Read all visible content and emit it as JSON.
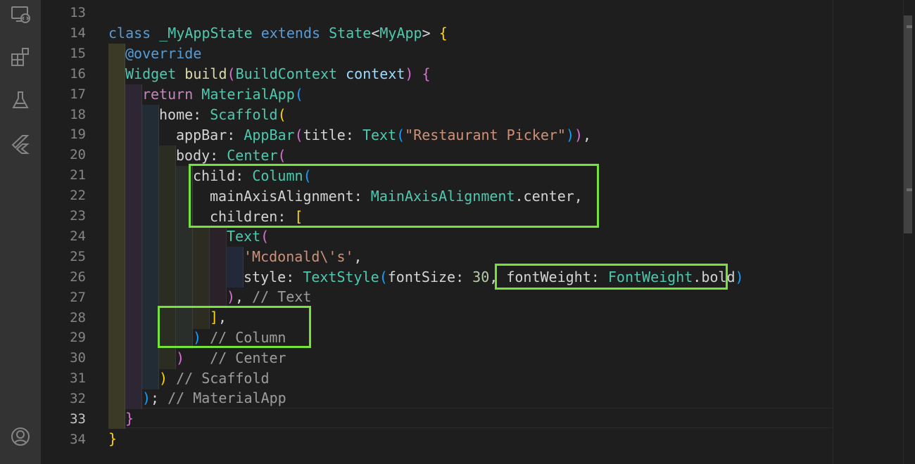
{
  "activity_bar": {
    "items": [
      {
        "name": "remote-explorer-icon"
      },
      {
        "name": "extensions-icon"
      },
      {
        "name": "testing-icon"
      },
      {
        "name": "flutter-icon"
      }
    ],
    "bottom": [
      {
        "name": "account-icon"
      }
    ]
  },
  "editor": {
    "active_line": 33,
    "lines": [
      {
        "n": 13,
        "text": ""
      },
      {
        "n": 14,
        "text": "class _MyAppState extends State<MyApp> {"
      },
      {
        "n": 15,
        "text": "@override"
      },
      {
        "n": 16,
        "text": "Widget build(BuildContext context) {"
      },
      {
        "n": 17,
        "text": "return MaterialApp("
      },
      {
        "n": 18,
        "text": "home: Scaffold("
      },
      {
        "n": 19,
        "text": "appBar: AppBar(title: Text(\"Restaurant Picker\")),"
      },
      {
        "n": 20,
        "text": "body: Center("
      },
      {
        "n": 21,
        "text": "child: Column("
      },
      {
        "n": 22,
        "text": "mainAxisAlignment: MainAxisAlignment.center,"
      },
      {
        "n": 23,
        "text": "children: ["
      },
      {
        "n": 24,
        "text": "Text("
      },
      {
        "n": 25,
        "text": "'Mcdonald\\'s',"
      },
      {
        "n": 26,
        "text": "style: TextStyle(fontSize: 30, fontWeight: FontWeight.bold)"
      },
      {
        "n": 27,
        "text": "), // Text"
      },
      {
        "n": 28,
        "text": "],"
      },
      {
        "n": 29,
        "text": ") // Column"
      },
      {
        "n": 30,
        "text": ")   // Center"
      },
      {
        "n": 31,
        "text": ") // Scaffold"
      },
      {
        "n": 32,
        "text": "); // MaterialApp"
      },
      {
        "n": 33,
        "text": "}"
      },
      {
        "n": 34,
        "text": "}"
      }
    ]
  },
  "code_tokens": {
    "l14": {
      "class": "class",
      "name": "_MyAppState",
      "extends": "extends",
      "state": "State",
      "lt": "<",
      "myapp": "MyApp",
      "gt": ">",
      "brace": "{"
    },
    "l15": {
      "override": "@override"
    },
    "l16": {
      "widget": "Widget",
      "build": "build",
      "lp": "(",
      "ctx_type": "BuildContext",
      "ctx": "context",
      "rp": ")",
      "brace": "{"
    },
    "l17": {
      "return": "return",
      "app": "MaterialApp",
      "lp": "("
    },
    "l18": {
      "home": "home",
      "colon": ": ",
      "scaffold": "Scaffold",
      "lp": "("
    },
    "l19": {
      "appbar_prop": "appBar",
      "colon": ": ",
      "appbar": "AppBar",
      "lp": "(",
      "title": "title",
      "colon2": ": ",
      "text": "Text",
      "lp2": "(",
      "str": "\"Restaurant Picker\"",
      "rp2": ")",
      "rp": ")",
      "comma": ","
    },
    "l20": {
      "body": "body",
      "colon": ": ",
      "center": "Center",
      "lp": "("
    },
    "l21": {
      "child": "child",
      "colon": ": ",
      "column": "Column",
      "lp": "("
    },
    "l22": {
      "prop": "mainAxisAlignment",
      "colon": ": ",
      "type": "MainAxisAlignment",
      "dot": ".",
      "val": "center",
      "comma": ","
    },
    "l23": {
      "children": "children",
      "colon": ": ",
      "lb": "["
    },
    "l24": {
      "text": "Text",
      "lp": "("
    },
    "l25": {
      "str": "'Mcdonald\\'s'",
      "comma": ","
    },
    "l26": {
      "style": "style",
      "colon": ": ",
      "ts": "TextStyle",
      "lp": "(",
      "fs": "fontSize",
      "colon2": ": ",
      "num": "30",
      "comma": ", ",
      "fw": "fontWeight",
      "colon3": ": ",
      "fwt": "FontWeight",
      "dot": ".",
      "bold": "bold",
      "rp": ")"
    },
    "l27": {
      "rp": ")",
      "comma": ", ",
      "cm": "// Text"
    },
    "l28": {
      "rb": "]",
      "comma": ","
    },
    "l29": {
      "rp": ")",
      "cm": " // Column"
    },
    "l30": {
      "rp": ")",
      "cm": "   // Center"
    },
    "l31": {
      "rp": ")",
      "cm": " // Scaffold"
    },
    "l32": {
      "rp": ")",
      "semi": "; ",
      "cm": "// MaterialApp"
    },
    "l33": {
      "rb": "}"
    },
    "l34": {
      "rb": "}"
    }
  },
  "colors": {
    "highlight_box": "#76e33b",
    "background": "#1e1e1e",
    "activity_bar": "#333333"
  }
}
